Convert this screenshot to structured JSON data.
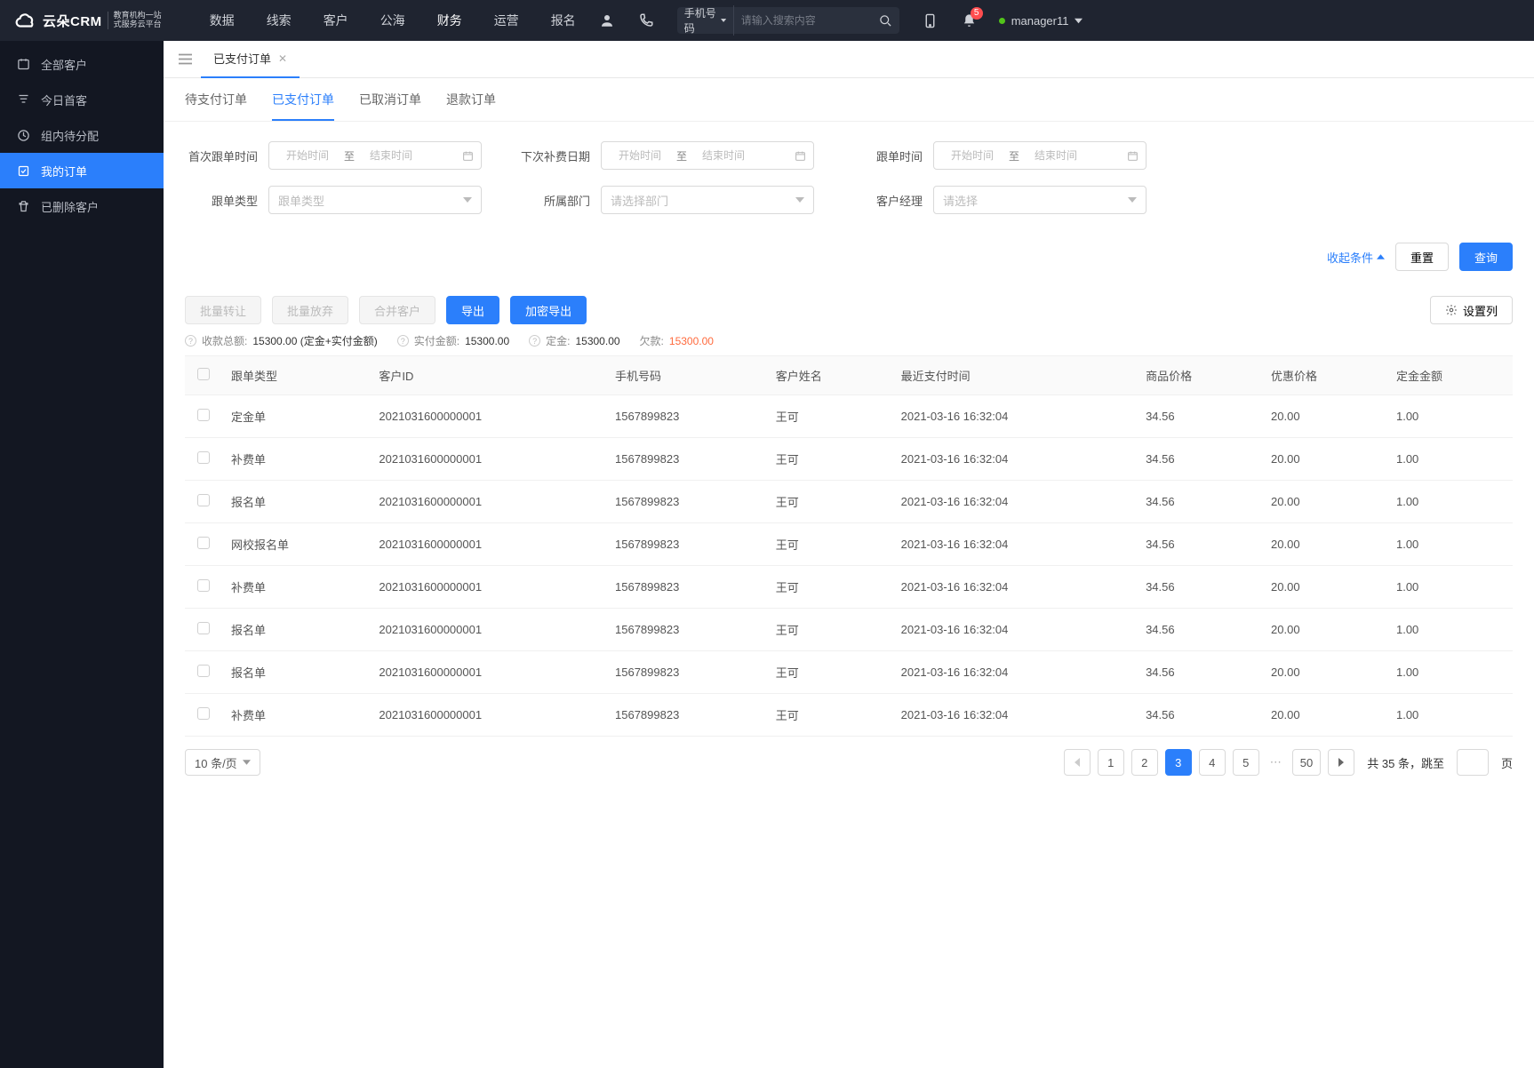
{
  "header": {
    "brand_name": "云朵CRM",
    "brand_sub_line1": "教育机构一站",
    "brand_sub_line2": "式服务云平台",
    "nav": [
      "数据",
      "线索",
      "客户",
      "公海",
      "财务",
      "运营",
      "报名"
    ],
    "nav_active_index": 4,
    "search_type": "手机号码",
    "search_placeholder": "请输入搜索内容",
    "notif_count": "5",
    "user_name": "manager11"
  },
  "sidebar": {
    "items": [
      "全部客户",
      "今日首客",
      "组内待分配",
      "我的订单",
      "已删除客户"
    ],
    "active_index": 3
  },
  "page": {
    "tab_label": "已支付订单",
    "sub_tabs": [
      "待支付订单",
      "已支付订单",
      "已取消订单",
      "退款订单"
    ],
    "sub_active_index": 1
  },
  "filters": {
    "first_follow_label": "首次跟单时间",
    "next_fee_label": "下次补费日期",
    "follow_time_label": "跟单时间",
    "follow_type_label": "跟单类型",
    "dept_label": "所属部门",
    "manager_label": "客户经理",
    "start_ph": "开始时间",
    "end_ph": "结束时间",
    "to_text": "至",
    "follow_type_ph": "跟单类型",
    "dept_ph": "请选择部门",
    "manager_ph": "请选择",
    "collapse_text": "收起条件",
    "reset_btn": "重置",
    "query_btn": "查询"
  },
  "toolbar": {
    "batch_transfer": "批量转让",
    "batch_giveup": "批量放弃",
    "merge_customer": "合并客户",
    "export": "导出",
    "encrypt_export": "加密导出",
    "set_columns": "设置列"
  },
  "summary": {
    "total_label": "收款总额:",
    "total_value": "15300.00 (定金+实付金额)",
    "paid_label": "实付金额:",
    "paid_value": "15300.00",
    "deposit_label": "定金:",
    "deposit_value": "15300.00",
    "due_label": "欠款:",
    "due_value": "15300.00"
  },
  "table": {
    "headers": [
      "跟单类型",
      "客户ID",
      "手机号码",
      "客户姓名",
      "最近支付时间",
      "商品价格",
      "优惠价格",
      "定金金额"
    ],
    "rows": [
      {
        "type": "定金单",
        "cid": "2021031600000001",
        "phone": "1567899823",
        "name": "王可",
        "paytime": "2021-03-16 16:32:04",
        "price": "34.56",
        "discount": "20.00",
        "deposit": "1.00"
      },
      {
        "type": "补费单",
        "cid": "2021031600000001",
        "phone": "1567899823",
        "name": "王可",
        "paytime": "2021-03-16 16:32:04",
        "price": "34.56",
        "discount": "20.00",
        "deposit": "1.00"
      },
      {
        "type": "报名单",
        "cid": "2021031600000001",
        "phone": "1567899823",
        "name": "王可",
        "paytime": "2021-03-16 16:32:04",
        "price": "34.56",
        "discount": "20.00",
        "deposit": "1.00"
      },
      {
        "type": "网校报名单",
        "cid": "2021031600000001",
        "phone": "1567899823",
        "name": "王可",
        "paytime": "2021-03-16 16:32:04",
        "price": "34.56",
        "discount": "20.00",
        "deposit": "1.00"
      },
      {
        "type": "补费单",
        "cid": "2021031600000001",
        "phone": "1567899823",
        "name": "王可",
        "paytime": "2021-03-16 16:32:04",
        "price": "34.56",
        "discount": "20.00",
        "deposit": "1.00"
      },
      {
        "type": "报名单",
        "cid": "2021031600000001",
        "phone": "1567899823",
        "name": "王可",
        "paytime": "2021-03-16 16:32:04",
        "price": "34.56",
        "discount": "20.00",
        "deposit": "1.00"
      },
      {
        "type": "报名单",
        "cid": "2021031600000001",
        "phone": "1567899823",
        "name": "王可",
        "paytime": "2021-03-16 16:32:04",
        "price": "34.56",
        "discount": "20.00",
        "deposit": "1.00"
      },
      {
        "type": "补费单",
        "cid": "2021031600000001",
        "phone": "1567899823",
        "name": "王可",
        "paytime": "2021-03-16 16:32:04",
        "price": "34.56",
        "discount": "20.00",
        "deposit": "1.00"
      }
    ]
  },
  "pager": {
    "page_size_label": "10 条/页",
    "pages": [
      "1",
      "2",
      "3",
      "4",
      "5"
    ],
    "last_page": "50",
    "active_index": 2,
    "total_prefix": "共 ",
    "total_count": "35",
    "total_suffix": " 条，跳至",
    "page_suffix": "页"
  }
}
